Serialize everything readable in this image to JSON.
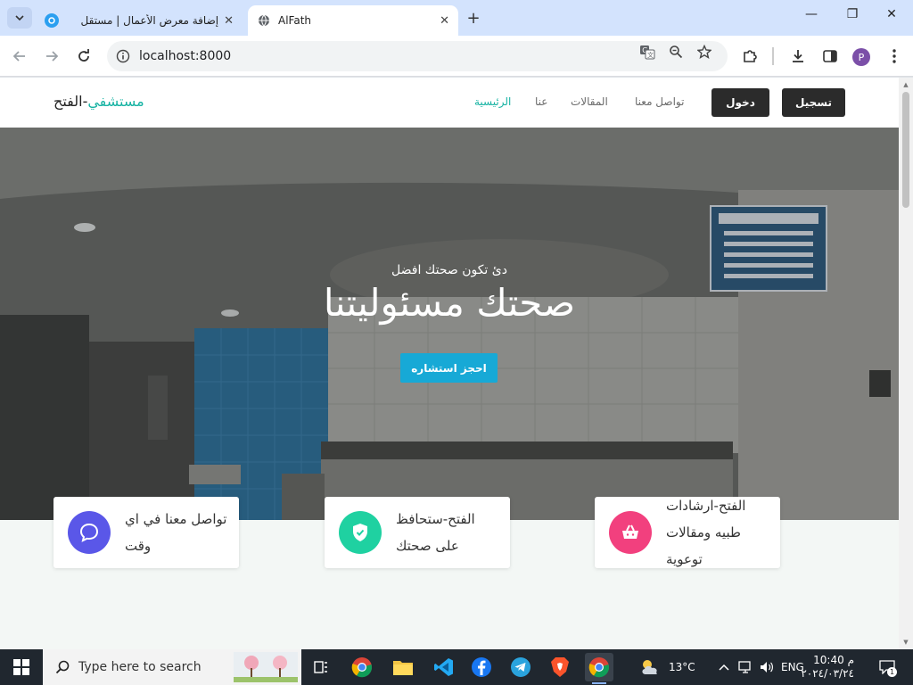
{
  "browser": {
    "tabs": [
      {
        "title": "إضافة معرض الأعمال | مستقل",
        "favicon": "mostaql-icon",
        "active": false
      },
      {
        "title": "AlFath",
        "favicon": "globe-icon",
        "active": true
      }
    ],
    "address": "localhost:8000",
    "profile_initial": "P"
  },
  "site": {
    "brand_part1": "مستشفي",
    "brand_part2": "-الفتح",
    "nav": {
      "home": "الرئيسية",
      "about": "عنا",
      "articles": "المقالات",
      "contact": "تواصل معنا",
      "login": "دخول",
      "register": "تسجيل"
    },
    "hero": {
      "subtitle": "دئ تكون صحتك افضل",
      "title": "صحتك مسئوليتنا",
      "cta": "احجز استشاره"
    },
    "features": [
      {
        "text": "تواصل معنا في اي وقت",
        "icon": "chat-bubble-icon",
        "color": "#5a57e8"
      },
      {
        "text": "الفتح-ستحافظ على صحتك",
        "icon": "shield-check-icon",
        "color": "#1fd1a1"
      },
      {
        "text": "الفتح-ارشادات طبيه ومقالات توعوية",
        "icon": "basket-icon",
        "color": "#f2407e"
      }
    ]
  },
  "taskbar": {
    "search_placeholder": "Type here to search",
    "weather": "13°C",
    "language": "ENG",
    "time": "10:40 م",
    "date": "٢٠٢٤/٠٣/٢٤",
    "notifications": "1"
  },
  "colors": {
    "accent": "#17b3a3",
    "cta": "#17a9d6",
    "dark_button": "#2b2b2b"
  }
}
